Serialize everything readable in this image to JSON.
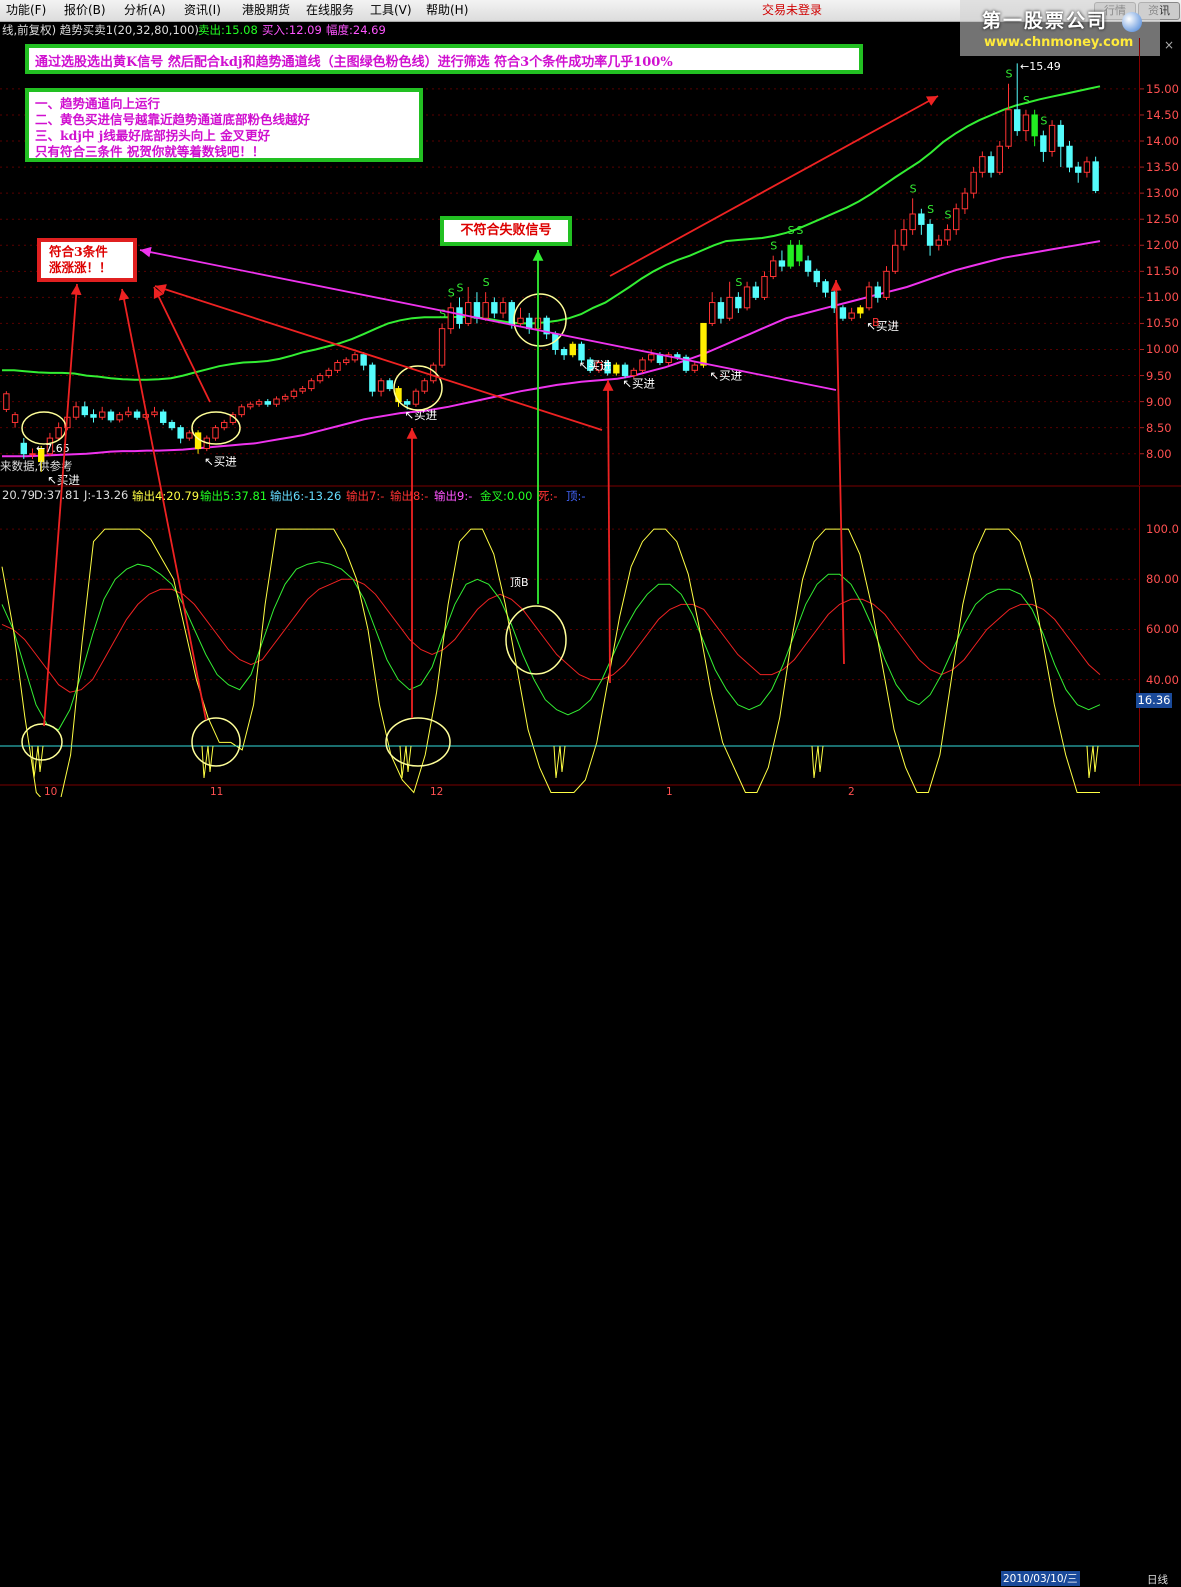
{
  "menu": [
    "功能(F)",
    "报价(B)",
    "分析(A)",
    "资讯(I)",
    "港股期货",
    "在线服务",
    "工具(V)",
    "帮助(H)"
  ],
  "trade_status": "交易未登录",
  "logo": {
    "line1": "第一股票公司",
    "line2": "www.chnmoney.com"
  },
  "window_buttons": [
    "行情",
    "资讯"
  ],
  "info": {
    "title": "线,前复权) 趋势买卖1(20,32,80,100)",
    "sell": "卖出:15.08",
    "buy": "买入:12.09",
    "range": "幅度:24.69",
    "close": "×"
  },
  "annotations": {
    "top": "通过选股选出黄K信号  然后配合kdj和趋势通道线（主图绿色粉色线）进行筛选  符合3个条件成功率几乎100%",
    "cond1": "一、趋势通道向上运行",
    "cond2": "二、黄色买进信号越靠近趋势通道底部粉色线越好",
    "cond3": "三、kdj中  j线最好底部拐头向上  金叉更好",
    "cond4": "只有符合三条件  祝贺你就等着数钱吧！！",
    "fail": "不符合失败信号",
    "ok1": "符合3条件",
    "ok2": "涨涨涨！！"
  },
  "chart_labels": {
    "buy": "买进",
    "sell_mark": "S",
    "b_mark": "B",
    "peak_label": "顶B",
    "low_price": "7.65",
    "high_price": "15.49",
    "disclaimer": "来数据,供参考"
  },
  "price_axis": [
    "15.00",
    "14.50",
    "14.00",
    "13.50",
    "13.00",
    "12.50",
    "12.00",
    "11.50",
    "11.00",
    "10.50",
    "10.00",
    "9.50",
    "9.00",
    "8.50",
    "8.00"
  ],
  "indicator_header": {
    "k": "20.79",
    "d": "D:37.81",
    "j": "J:-13.26",
    "o4": "输出4:20.79",
    "o5": "输出5:37.81",
    "o6": "输出6:-13.26",
    "o7": "输出7:-",
    "o8": "输出8:-",
    "o9": "输出9:-",
    "gold": "金叉:0.00",
    "dead": "死:-",
    "top": "顶:-"
  },
  "indicator_axis": [
    "100.0",
    "80.00",
    "60.00",
    "40.00"
  ],
  "indicator_current": "16.36",
  "x_axis": [
    "10",
    "11",
    "12",
    "1",
    "2"
  ],
  "x_date": "2010/03/10/三",
  "x_unit": "日线",
  "chart_data": {
    "type": "candlestick",
    "price_range": [
      7.4,
      15.9
    ],
    "indicator_range": [
      0,
      110
    ],
    "candles": [
      [
        8.85,
        9.15,
        9.2,
        8.8
      ],
      [
        8.6,
        8.75,
        8.8,
        8.5
      ],
      [
        8.2,
        8.0,
        8.3,
        7.9
      ],
      [
        8.0,
        8.0,
        8.1,
        7.9
      ],
      [
        8.1,
        7.85,
        8.15,
        7.65
      ],
      [
        8.0,
        8.3,
        8.4,
        7.95
      ],
      [
        8.3,
        8.5,
        8.6,
        8.25
      ],
      [
        8.5,
        8.7,
        8.8,
        8.45
      ],
      [
        8.7,
        8.9,
        9.0,
        8.65
      ],
      [
        8.9,
        8.75,
        9.0,
        8.7
      ],
      [
        8.75,
        8.7,
        8.85,
        8.6
      ],
      [
        8.7,
        8.8,
        8.9,
        8.65
      ],
      [
        8.8,
        8.65,
        8.85,
        8.6
      ],
      [
        8.65,
        8.75,
        8.8,
        8.6
      ],
      [
        8.75,
        8.8,
        8.9,
        8.7
      ],
      [
        8.8,
        8.7,
        8.85,
        8.65
      ],
      [
        8.7,
        8.75,
        8.8,
        8.65
      ],
      [
        8.75,
        8.8,
        8.9,
        8.7
      ],
      [
        8.8,
        8.6,
        8.85,
        8.55
      ],
      [
        8.6,
        8.5,
        8.65,
        8.45
      ],
      [
        8.5,
        8.3,
        8.55,
        8.2
      ],
      [
        8.3,
        8.4,
        8.45,
        8.25
      ],
      [
        8.4,
        8.1,
        8.45,
        8.0
      ],
      [
        8.1,
        8.3,
        8.35,
        8.05
      ],
      [
        8.3,
        8.5,
        8.55,
        8.25
      ],
      [
        8.5,
        8.6,
        8.65,
        8.45
      ],
      [
        8.6,
        8.75,
        8.8,
        8.55
      ],
      [
        8.75,
        8.9,
        8.95,
        8.7
      ],
      [
        8.9,
        8.95,
        9.0,
        8.85
      ],
      [
        8.95,
        9.0,
        9.05,
        8.9
      ],
      [
        9.0,
        8.95,
        9.05,
        8.9
      ],
      [
        8.95,
        9.05,
        9.1,
        8.9
      ],
      [
        9.05,
        9.1,
        9.15,
        9.0
      ],
      [
        9.1,
        9.2,
        9.25,
        9.05
      ],
      [
        9.2,
        9.25,
        9.3,
        9.15
      ],
      [
        9.25,
        9.4,
        9.45,
        9.2
      ],
      [
        9.4,
        9.5,
        9.55,
        9.35
      ],
      [
        9.5,
        9.6,
        9.65,
        9.45
      ],
      [
        9.6,
        9.75,
        9.8,
        9.55
      ],
      [
        9.75,
        9.8,
        9.85,
        9.7
      ],
      [
        9.8,
        9.9,
        9.95,
        9.75
      ],
      [
        9.9,
        9.7,
        9.95,
        9.6
      ],
      [
        9.7,
        9.2,
        9.75,
        9.1
      ],
      [
        9.2,
        9.4,
        9.45,
        9.1
      ],
      [
        9.4,
        9.25,
        9.45,
        9.2
      ],
      [
        9.25,
        9.0,
        9.3,
        8.9
      ],
      [
        9.0,
        8.95,
        9.05,
        8.85
      ],
      [
        8.95,
        9.2,
        9.25,
        8.9
      ],
      [
        9.2,
        9.4,
        9.45,
        9.15
      ],
      [
        9.4,
        9.7,
        9.75,
        9.35
      ],
      [
        9.7,
        10.4,
        10.5,
        9.65
      ],
      [
        10.4,
        10.8,
        10.9,
        10.3
      ],
      [
        10.8,
        10.5,
        11.0,
        10.4
      ],
      [
        10.5,
        10.9,
        11.2,
        10.45
      ],
      [
        10.9,
        10.6,
        11.1,
        10.5
      ],
      [
        10.6,
        10.9,
        11.1,
        10.55
      ],
      [
        10.9,
        10.7,
        11.0,
        10.6
      ],
      [
        10.7,
        10.9,
        11.0,
        10.6
      ],
      [
        10.9,
        10.5,
        10.95,
        10.4
      ],
      [
        10.5,
        10.6,
        10.8,
        10.45
      ],
      [
        10.6,
        10.4,
        10.7,
        10.3
      ],
      [
        10.4,
        10.6,
        10.7,
        10.35
      ],
      [
        10.6,
        10.3,
        10.65,
        10.2
      ],
      [
        10.3,
        10.0,
        10.35,
        9.9
      ],
      [
        10.0,
        9.9,
        10.05,
        9.8
      ],
      [
        9.9,
        10.1,
        10.15,
        9.85
      ],
      [
        10.1,
        9.8,
        10.15,
        9.75
      ],
      [
        9.8,
        9.6,
        9.85,
        9.55
      ],
      [
        9.6,
        9.75,
        9.8,
        9.55
      ],
      [
        9.75,
        9.55,
        9.8,
        9.5
      ],
      [
        9.55,
        9.7,
        9.75,
        9.5
      ],
      [
        9.7,
        9.5,
        9.75,
        9.45
      ],
      [
        9.5,
        9.6,
        9.65,
        9.45
      ],
      [
        9.6,
        9.8,
        9.85,
        9.55
      ],
      [
        9.8,
        9.9,
        10.0,
        9.75
      ],
      [
        9.9,
        9.75,
        9.95,
        9.7
      ],
      [
        9.75,
        9.9,
        9.95,
        9.7
      ],
      [
        9.9,
        9.85,
        9.95,
        9.8
      ],
      [
        9.85,
        9.6,
        9.9,
        9.55
      ],
      [
        9.6,
        9.7,
        9.75,
        9.55
      ],
      [
        9.7,
        10.5,
        10.5,
        9.65
      ],
      [
        10.5,
        10.9,
        11.1,
        10.45
      ],
      [
        10.9,
        10.6,
        11.0,
        10.5
      ],
      [
        10.6,
        11.0,
        11.3,
        10.55
      ],
      [
        11.0,
        10.8,
        11.1,
        10.7
      ],
      [
        10.8,
        11.2,
        11.3,
        10.75
      ],
      [
        11.2,
        11.0,
        11.3,
        10.95
      ],
      [
        11.0,
        11.4,
        11.5,
        10.95
      ],
      [
        11.4,
        11.7,
        11.8,
        11.35
      ],
      [
        11.7,
        11.6,
        11.9,
        11.5
      ],
      [
        11.6,
        12.0,
        12.1,
        11.55
      ],
      [
        12.0,
        11.7,
        12.1,
        11.6
      ],
      [
        11.7,
        11.5,
        11.8,
        11.4
      ],
      [
        11.5,
        11.3,
        11.55,
        11.2
      ],
      [
        11.3,
        11.1,
        11.35,
        11.0
      ],
      [
        11.1,
        10.8,
        11.15,
        10.7
      ],
      [
        10.8,
        10.6,
        10.85,
        10.55
      ],
      [
        10.6,
        10.7,
        10.8,
        10.55
      ],
      [
        10.7,
        10.8,
        10.85,
        10.6
      ],
      [
        10.8,
        11.2,
        11.3,
        10.75
      ],
      [
        11.2,
        11.0,
        11.3,
        10.9
      ],
      [
        11.0,
        11.5,
        11.6,
        10.95
      ],
      [
        11.5,
        12.0,
        12.3,
        11.45
      ],
      [
        12.0,
        12.3,
        12.5,
        11.9
      ],
      [
        12.3,
        12.6,
        12.9,
        12.2
      ],
      [
        12.6,
        12.4,
        12.7,
        12.2
      ],
      [
        12.4,
        12.0,
        12.5,
        11.8
      ],
      [
        12.0,
        12.1,
        12.2,
        11.9
      ],
      [
        12.1,
        12.3,
        12.4,
        12.0
      ],
      [
        12.3,
        12.7,
        12.8,
        12.2
      ],
      [
        12.7,
        13.0,
        13.1,
        12.6
      ],
      [
        13.0,
        13.4,
        13.5,
        12.9
      ],
      [
        13.4,
        13.7,
        13.8,
        13.3
      ],
      [
        13.7,
        13.4,
        13.8,
        13.3
      ],
      [
        13.4,
        13.9,
        14.0,
        13.35
      ],
      [
        13.9,
        14.6,
        15.1,
        13.85
      ],
      [
        14.6,
        14.2,
        15.49,
        14.1
      ],
      [
        14.2,
        14.5,
        14.6,
        14.0
      ],
      [
        14.5,
        14.1,
        14.6,
        13.9
      ],
      [
        14.1,
        13.8,
        14.2,
        13.6
      ],
      [
        13.8,
        14.3,
        14.4,
        13.7
      ],
      [
        14.3,
        13.9,
        14.4,
        13.5
      ],
      [
        13.9,
        13.5,
        14.0,
        13.4
      ],
      [
        13.5,
        13.4,
        13.6,
        13.2
      ],
      [
        13.4,
        13.6,
        13.7,
        13.3
      ],
      [
        13.6,
        13.05,
        13.7,
        13.0
      ]
    ],
    "yellow_signals": [
      4,
      22,
      45,
      65,
      70,
      80,
      98
    ],
    "green_candles": [
      90,
      91,
      118
    ],
    "upper_band": [
      9.6,
      9.6,
      9.58,
      9.56,
      9.55,
      9.55,
      9.54,
      9.5,
      9.48,
      9.45,
      9.43,
      9.42,
      9.42,
      9.43,
      9.45,
      9.5,
      9.56,
      9.62,
      9.68,
      9.72,
      9.75,
      9.76,
      9.78,
      9.82,
      9.88,
      9.95,
      10.0,
      10.06,
      10.12,
      10.2,
      10.3,
      10.4,
      10.5,
      10.56,
      10.6,
      10.62,
      10.62,
      10.62,
      10.63,
      10.62,
      10.6,
      10.56,
      10.52,
      10.5,
      10.5,
      10.52,
      10.55,
      10.6,
      10.68,
      10.8,
      10.9,
      11.05,
      11.2,
      11.36,
      11.5,
      11.62,
      11.72,
      11.8,
      11.9,
      12.0,
      12.08,
      12.1,
      12.12,
      12.14,
      12.18,
      12.24,
      12.32,
      12.42,
      12.52,
      12.62,
      12.72,
      12.84,
      12.98,
      13.14,
      13.3,
      13.45,
      13.6,
      13.78,
      13.98,
      14.14,
      14.28,
      14.4,
      14.5,
      14.6,
      14.68,
      14.74,
      14.8,
      14.85,
      14.9,
      14.95,
      15.0,
      15.05
    ],
    "lower_band": [
      7.95,
      7.95,
      7.95,
      7.96,
      7.97,
      7.98,
      7.99,
      8.0,
      8.02,
      8.04,
      8.05,
      8.05,
      8.06,
      8.06,
      8.07,
      8.08,
      8.1,
      8.12,
      8.14,
      8.16,
      8.18,
      8.2,
      8.24,
      8.28,
      8.32,
      8.36,
      8.42,
      8.48,
      8.54,
      8.6,
      8.66,
      8.7,
      8.74,
      8.78,
      8.8,
      8.82,
      8.86,
      8.9,
      8.95,
      9.0,
      9.05,
      9.1,
      9.15,
      9.2,
      9.24,
      9.28,
      9.32,
      9.35,
      9.38,
      9.4,
      9.42,
      9.44,
      9.48,
      9.54,
      9.6,
      9.66,
      9.74,
      9.82,
      9.9,
      10.0,
      10.1,
      10.2,
      10.3,
      10.4,
      10.5,
      10.6,
      10.66,
      10.72,
      10.78,
      10.84,
      10.9,
      10.96,
      11.02,
      11.08,
      11.14,
      11.2,
      11.28,
      11.36,
      11.44,
      11.52,
      11.58,
      11.64,
      11.7,
      11.76,
      11.8,
      11.84,
      11.88,
      11.92,
      11.96,
      12.0,
      12.04,
      12.08
    ],
    "kdj": {
      "k": [
        70,
        60,
        45,
        30,
        22,
        20,
        28,
        42,
        58,
        72,
        80,
        84,
        86,
        85,
        82,
        78,
        70,
        60,
        50,
        42,
        38,
        36,
        42,
        55,
        68,
        78,
        84,
        86,
        87,
        86,
        84,
        80,
        72,
        60,
        48,
        40,
        36,
        38,
        45,
        58,
        70,
        78,
        80,
        78,
        72,
        62,
        50,
        40,
        32,
        28,
        26,
        28,
        32,
        40,
        50,
        60,
        68,
        74,
        78,
        78,
        74,
        66,
        55,
        44,
        36,
        30,
        28,
        30,
        36,
        46,
        58,
        70,
        78,
        82,
        82,
        78,
        70,
        60,
        48,
        38,
        32,
        30,
        34,
        42,
        52,
        62,
        70,
        74,
        76,
        76,
        74,
        68,
        58,
        46,
        36,
        30,
        28,
        30
      ],
      "d": [
        62,
        60,
        56,
        50,
        44,
        38,
        35,
        36,
        40,
        48,
        56,
        64,
        70,
        74,
        76,
        76,
        74,
        70,
        64,
        58,
        52,
        48,
        46,
        48,
        54,
        60,
        66,
        72,
        76,
        78,
        80,
        80,
        78,
        74,
        68,
        62,
        56,
        52,
        50,
        52,
        56,
        62,
        68,
        72,
        74,
        72,
        68,
        62,
        56,
        50,
        46,
        42,
        40,
        40,
        42,
        46,
        52,
        58,
        64,
        68,
        70,
        70,
        68,
        62,
        56,
        50,
        46,
        42,
        42,
        44,
        48,
        54,
        60,
        66,
        70,
        72,
        72,
        70,
        66,
        60,
        54,
        48,
        44,
        42,
        44,
        48,
        54,
        60,
        64,
        68,
        70,
        70,
        68,
        64,
        58,
        52,
        46,
        42
      ],
      "j": [
        85,
        60,
        25,
        -5,
        -10,
        -10,
        10,
        55,
        95,
        100,
        100,
        100,
        100,
        96,
        88,
        80,
        60,
        40,
        25,
        15,
        15,
        12,
        30,
        70,
        100,
        100,
        100,
        100,
        100,
        100,
        92,
        80,
        60,
        30,
        10,
        0,
        -5,
        10,
        35,
        70,
        95,
        100,
        100,
        90,
        70,
        45,
        20,
        5,
        -5,
        -5,
        -5,
        0,
        15,
        40,
        65,
        85,
        95,
        100,
        100,
        95,
        82,
        60,
        35,
        15,
        5,
        -5,
        -5,
        5,
        25,
        55,
        80,
        95,
        100,
        100,
        100,
        90,
        70,
        45,
        20,
        5,
        -5,
        -5,
        10,
        40,
        70,
        90,
        100,
        100,
        100,
        95,
        80,
        55,
        30,
        10,
        -5,
        -5,
        -5
      ]
    }
  }
}
